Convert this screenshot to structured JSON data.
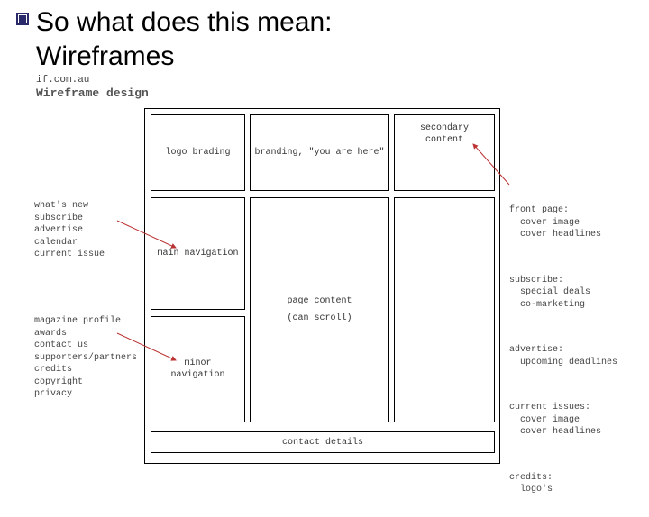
{
  "slide": {
    "title_line1": "So what does this mean:",
    "title_line2": "Wireframes"
  },
  "meta": {
    "site": "if.com.au",
    "design_label": "Wireframe design"
  },
  "boxes": {
    "logo": "logo\nbrading",
    "branding": "branding,\n\"you are here\"",
    "secondary": "secondary\ncontent",
    "nav": "main\nnavigation",
    "content_line1": "page content",
    "content_line2": "(can scroll)",
    "minor": "minor\nnavigation",
    "footer": "contact details"
  },
  "annotations": {
    "left_nav": "what's new\nsubscribe\nadvertise\ncalendar\ncurrent issue",
    "left_minor": "magazine profile\nawards\ncontact us\nsupporters/partners\ncredits\ncopyright\nprivacy",
    "right": {
      "g1": "front page:\n  cover image\n  cover headlines",
      "g2": "subscribe:\n  special deals\n  co-marketing",
      "g3": "advertise:\n  upcoming deadlines",
      "g4": "current issues:\n  cover image\n  cover headlines",
      "g5": "credits:\n  logo's"
    }
  }
}
